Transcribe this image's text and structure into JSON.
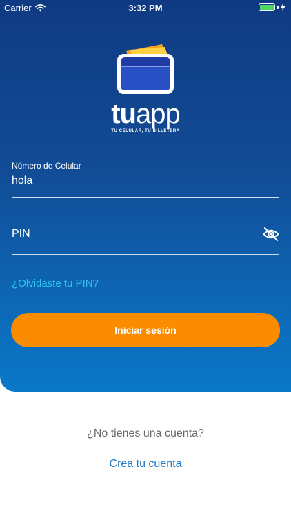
{
  "status_bar": {
    "carrier": "Carrier",
    "time": "3:32 PM",
    "battery_color": "#4cd964"
  },
  "logo": {
    "word_bold": "tu",
    "word_light": "app",
    "tagline": "TU CELULAR, TU BILLETERA",
    "icon": "wallet-icon"
  },
  "form": {
    "phone": {
      "label": "Número de Celular",
      "value": "hola"
    },
    "pin": {
      "placeholder": "PIN",
      "icon": "eye-slash-icon"
    },
    "forgot_pin": "¿Olvidaste tu PIN?",
    "login_label": "Iniciar sesión"
  },
  "footer": {
    "no_account": "¿No tienes una cuenta?",
    "create_account": "Crea tu cuenta"
  },
  "colors": {
    "primary": "#124d97",
    "accent": "#fb8c00",
    "link": "#2fc3f5",
    "footer_link": "#1f78c8"
  }
}
